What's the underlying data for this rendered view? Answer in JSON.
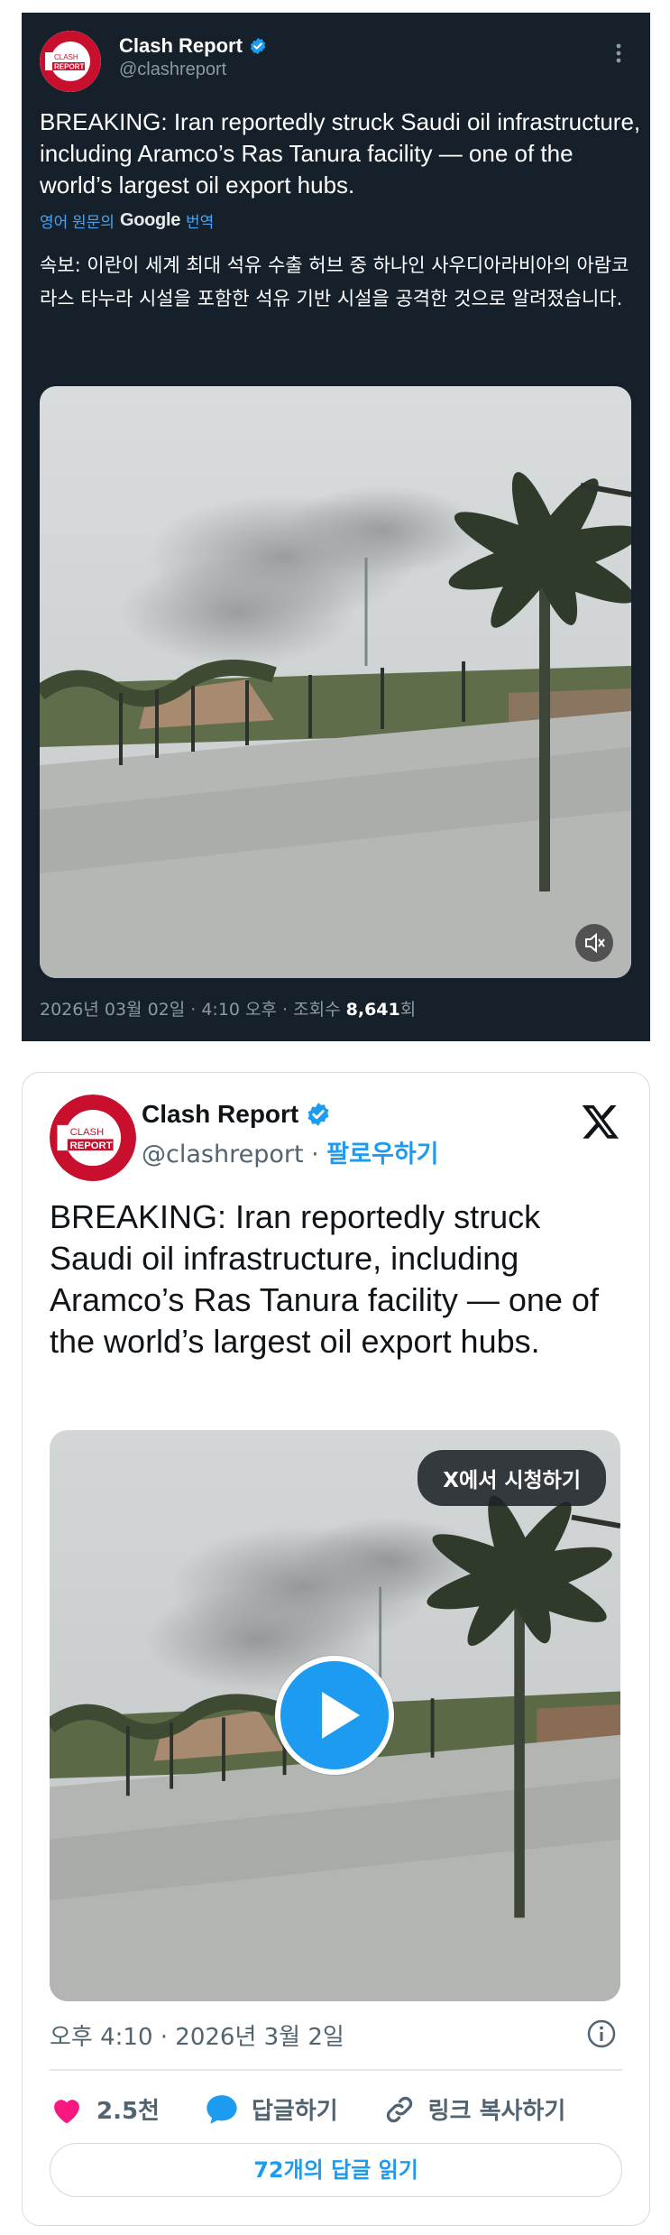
{
  "top_post": {
    "account_name": "Clash Report",
    "handle": "@clashreport",
    "logo_text_line1": "CLASH",
    "logo_text_line2": "REPORT",
    "text": "BREAKING: Iran reportedly struck Saudi oil infrastructure, including Aramco’s Ras Tanura facility — one of the world’s largest oil export hubs.",
    "translate_prefix": "영어 원문의",
    "translate_brand": "Google",
    "translate_suffix": "번역",
    "translated_text": "속보: 이란이 세계 최대 석유 수출 허브 중 하나인 사우디아라비아의 아람코 라스 타누라 시설을 포함한 석유 기반 시설을 공격한 것으로 알려졌습니다.",
    "date_time": "2026년 03월 02일 · 4:10 오후 · 조회수 ",
    "views": "8,641",
    "views_suffix": "회",
    "mute_icon": "mute-icon",
    "more_icon": "more-dots-icon"
  },
  "embed_card": {
    "account_name": "Clash Report",
    "handle": "@clashreport",
    "separator": " · ",
    "follow_label": "팔로우하기",
    "text": "BREAKING: Iran reportedly struck Saudi oil infrastructure, including Aramco’s Ras Tanura facility — one of the world’s largest oil export hubs.",
    "watch_on_x_label": "X에서 시청하기",
    "time": "오후 4:10 · 2026년 3월 2일",
    "likes": "2.5천",
    "reply_label": "답글하기",
    "copy_link_label": "링크 복사하기",
    "read_replies_label": "72개의 답글 읽기"
  },
  "colors": {
    "dark_bg": "#15202b",
    "accent_blue": "#1d9bf0",
    "like_pink": "#f91880",
    "logo_red": "#c8102e"
  }
}
